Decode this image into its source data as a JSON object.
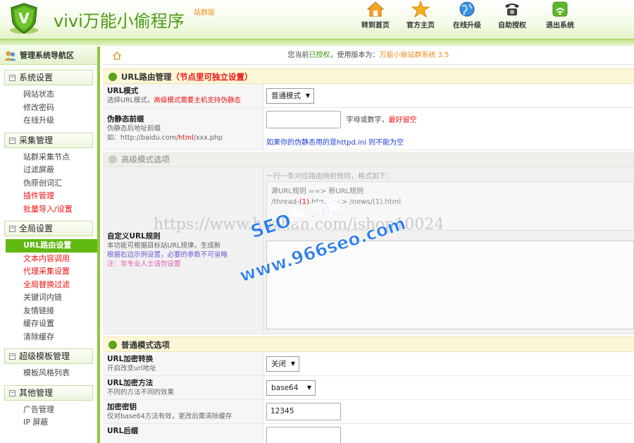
{
  "header": {
    "logo_letter": "V",
    "title": "vivi万能小偷程序",
    "badge": "站群版",
    "nav": [
      {
        "label": "转到首页",
        "icon": "home-icon"
      },
      {
        "label": "官方主页",
        "icon": "star-icon"
      },
      {
        "label": "在线升级",
        "icon": "globe-icon"
      },
      {
        "label": "自助授权",
        "icon": "telephone-icon"
      },
      {
        "label": "退出系统",
        "icon": "exit-icon"
      }
    ]
  },
  "sidebar": {
    "title": "管理系统导航区",
    "groups": [
      {
        "label": "系统设置",
        "items": [
          {
            "label": "网站状态"
          },
          {
            "label": "修改密码"
          },
          {
            "label": "在线升级"
          }
        ]
      },
      {
        "label": "采集管理",
        "items": [
          {
            "label": "站群采集节点"
          },
          {
            "label": "过滤屏蔽"
          },
          {
            "label": "伪原创词汇"
          },
          {
            "label": "插件管理"
          },
          {
            "label": "批量导入/设置"
          }
        ]
      },
      {
        "label": "全局设置",
        "items": [
          {
            "label": "URL路由设置"
          },
          {
            "label": "文本内容调用"
          },
          {
            "label": "代理采集设置"
          },
          {
            "label": "全局替换过滤"
          },
          {
            "label": "关键词内链"
          },
          {
            "label": "友情链接"
          },
          {
            "label": "缓存设置"
          },
          {
            "label": "清除缓存"
          }
        ]
      },
      {
        "label": "超级模板管理",
        "items": [
          {
            "label": "模板风格列表"
          }
        ]
      },
      {
        "label": "其他管理",
        "items": [
          {
            "label": "广告管理"
          },
          {
            "label": "IP 屏蔽"
          }
        ]
      }
    ]
  },
  "status": {
    "prefix": "您当前",
    "authorized": "已授权",
    "middle": "，使用版本为：",
    "version": "万能小偷站群系统 3.5"
  },
  "url_section": {
    "title": "URL路由管理",
    "note": "（节点里可独立设置）",
    "url_mode": {
      "label": "URL模式",
      "desc": "选择URL模式，",
      "desc_red": "高级模式需要主机支持伪静态",
      "value": "普通模式"
    },
    "pseudo_prefix": {
      "label": "伪静态前缀",
      "desc": "伪静态后地址前缀",
      "example_pre": "如：http://baidu.com/",
      "example_red": "html",
      "example_post": "/xxx.php",
      "value": "",
      "hint": "字母或数字，",
      "hint_red": "最好留空",
      "blue_note": "如果你的伪静态用的是httpd.ini 则不能为空"
    }
  },
  "advanced_section": {
    "title": "高级模式选项",
    "custom_rule": {
      "label": "自定义URL规则",
      "desc1": "本功能可根据目标站URL规律，生成新",
      "desc2": "根据右边示例设置，必要的参数不可省略",
      "desc3": "注：非专业人士请勿设置",
      "example_title": "一行一条对应路由映射规则，格式如下：",
      "example_line1": "源URL规则 ==> 新URL规则",
      "example_line2_pre": "/thread-",
      "example_line2_mid": "(1)",
      "example_line2_post": ".html ==> /news/(1).html"
    }
  },
  "normal_section": {
    "title": "普通模式选项",
    "url_encrypt": {
      "label": "URL加密转换",
      "desc": "开启改变url地址",
      "value": "关闭"
    },
    "encrypt_method": {
      "label": "URL加密方法",
      "desc": "不同的方法不同的效果",
      "value": "base64"
    },
    "encrypt_key": {
      "label": "加密密钥",
      "desc": "仅对base64方法有效，更改后需清除缓存",
      "value": "12345"
    },
    "url_suffix": {
      "label": "URL后缀"
    }
  },
  "watermark": {
    "line1": "SEO学习网",
    "line2": "www.966seo.com",
    "line3": "https://www.huzhan.com/ishop10024"
  },
  "colors": {
    "accent": "#61b812",
    "red": "#e11111",
    "blue": "#1f3fd6",
    "brand_green": "#4a9a14",
    "badge_orange": "#f28a1c"
  }
}
